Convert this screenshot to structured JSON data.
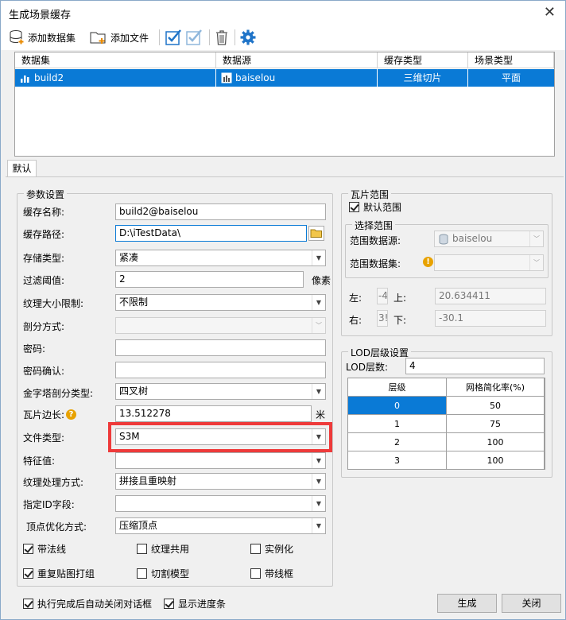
{
  "window": {
    "title": "生成场景缓存",
    "close_glyph": "✕"
  },
  "toolbar": {
    "add_dataset": "添加数据集",
    "add_file": "添加文件"
  },
  "dataset_table": {
    "headers": [
      "数据集",
      "数据源",
      "缓存类型",
      "场景类型"
    ],
    "rows": [
      {
        "dataset": "build2",
        "datasource": "baiselou",
        "cache_type": "三维切片",
        "scene_type": "平面"
      }
    ]
  },
  "tab": {
    "label": "默认"
  },
  "params": {
    "group_title": "参数设置",
    "cache_name_label": "缓存名称:",
    "cache_name_value": "build2@baiselou",
    "cache_path_label": "缓存路径:",
    "cache_path_value": "D:\\iTestData\\",
    "storage_type_label": "存储类型:",
    "storage_type_value": "紧凑",
    "filter_label": "过滤阈值:",
    "filter_value": "2",
    "filter_unit": "像素",
    "texture_limit_label": "纹理大小限制:",
    "texture_limit_value": "不限制",
    "split_mode_label": "剖分方式:",
    "split_mode_value": "",
    "password_label": "密码:",
    "password_value": "",
    "password_confirm_label": "密码确认:",
    "password_confirm_value": "",
    "pyramid_label": "金字塔剖分类型:",
    "pyramid_value": "四叉树",
    "tile_edge_label": "瓦片边长:",
    "tile_edge_value": "13.512278",
    "tile_edge_unit": "米",
    "file_type_label": "文件类型:",
    "file_type_value": "S3M",
    "feature_label": "特征值:",
    "feature_value": "",
    "texture_proc_label": "纹理处理方式:",
    "texture_proc_value": "拼接且重映射",
    "id_field_label": "指定ID字段:",
    "id_field_value": "",
    "vertex_opt_label": "顶点优化方式:",
    "vertex_opt_value": "压缩顶点",
    "checkboxes": [
      {
        "label": "带法线",
        "checked": true
      },
      {
        "label": "纹理共用",
        "checked": false
      },
      {
        "label": "实例化",
        "checked": false
      },
      {
        "label": "重复贴图打组",
        "checked": true
      },
      {
        "label": "切割模型",
        "checked": false
      },
      {
        "label": "带线框",
        "checked": false
      }
    ]
  },
  "tile_range": {
    "group_title": "瓦片范围",
    "default_range_label": "默认范围",
    "default_range_checked": true,
    "select_group_title": "选择范围",
    "range_source_label": "范围数据源:",
    "range_source_value": "baiselou",
    "range_dataset_label": "范围数据集:",
    "range_dataset_value": "",
    "left_label": "左:",
    "left_value": "-4",
    "top_label": "上:",
    "top_value": "20.634411",
    "right_label": "右:",
    "right_value": "3!",
    "bottom_label": "下:",
    "bottom_value": "-30.1"
  },
  "lod": {
    "group_title": "LOD层级设置",
    "count_label": "LOD层数:",
    "count_value": "4",
    "headers": [
      "层级",
      "网格简化率(%)"
    ],
    "rows": [
      {
        "level": "0",
        "rate": "50"
      },
      {
        "level": "1",
        "rate": "75"
      },
      {
        "level": "2",
        "rate": "100"
      },
      {
        "level": "3",
        "rate": "100"
      }
    ]
  },
  "footer": {
    "auto_close_label": "执行完成后自动关闭对话框",
    "auto_close_checked": true,
    "show_progress_label": "显示进度条",
    "show_progress_checked": true,
    "generate_label": "生成",
    "close_label": "关闭"
  },
  "colors": {
    "selection": "#0a7ad6",
    "highlight_box": "#ee3a3a",
    "accent_icon": "#1f74c8"
  }
}
